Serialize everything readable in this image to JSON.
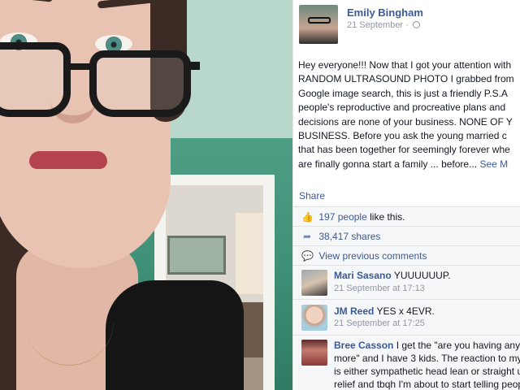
{
  "post": {
    "author_name": "Emily Bingham",
    "date": "21 September",
    "privacy_separator": "·",
    "body_lines": [
      "Hey everyone!!! Now that I got your attention with",
      "RANDOM ULTRASOUND PHOTO I grabbed from",
      "Google image search, this is just a friendly P.S.A",
      "people's reproductive and procreative plans and",
      "decisions are none of your business. NONE OF Y",
      "BUSINESS. Before you ask the young married c",
      "that has been together for seemingly forever whe",
      "are finally gonna start a family ... before..."
    ],
    "see_more_label": "See M",
    "share_label": "Share",
    "privacy_icon": "globe-icon"
  },
  "ufi": {
    "likes_count": "197",
    "likes_people_label": "people",
    "likes_suffix": "like this.",
    "shares_label": "38,417 shares",
    "view_previous_label": "View previous comments",
    "like_icon": "thumbs-up-icon",
    "share_icon": "share-arrow-icon",
    "comment_icon": "comment-bubble-icon"
  },
  "comments": [
    {
      "name": "Mari Sasano",
      "text": "YUUUUUUP.",
      "time": "21 September at 17:13"
    },
    {
      "name": "JM Reed",
      "text": "YES x 4EVR.",
      "time": "21 September at 17:25"
    },
    {
      "name": "Bree Casson",
      "text_lines": [
        "I get the \"are you having any",
        "more\" and I have 3 kids. The reaction to my",
        "is either sympathetic head lean or straight u",
        "relief and tbqh I'm about to start telling peop"
      ]
    }
  ],
  "colors": {
    "link_blue": "#3b5998",
    "meta_gray": "#9197a3",
    "ufi_bg": "#f6f7f9",
    "wall_green": "#4f9f86"
  }
}
